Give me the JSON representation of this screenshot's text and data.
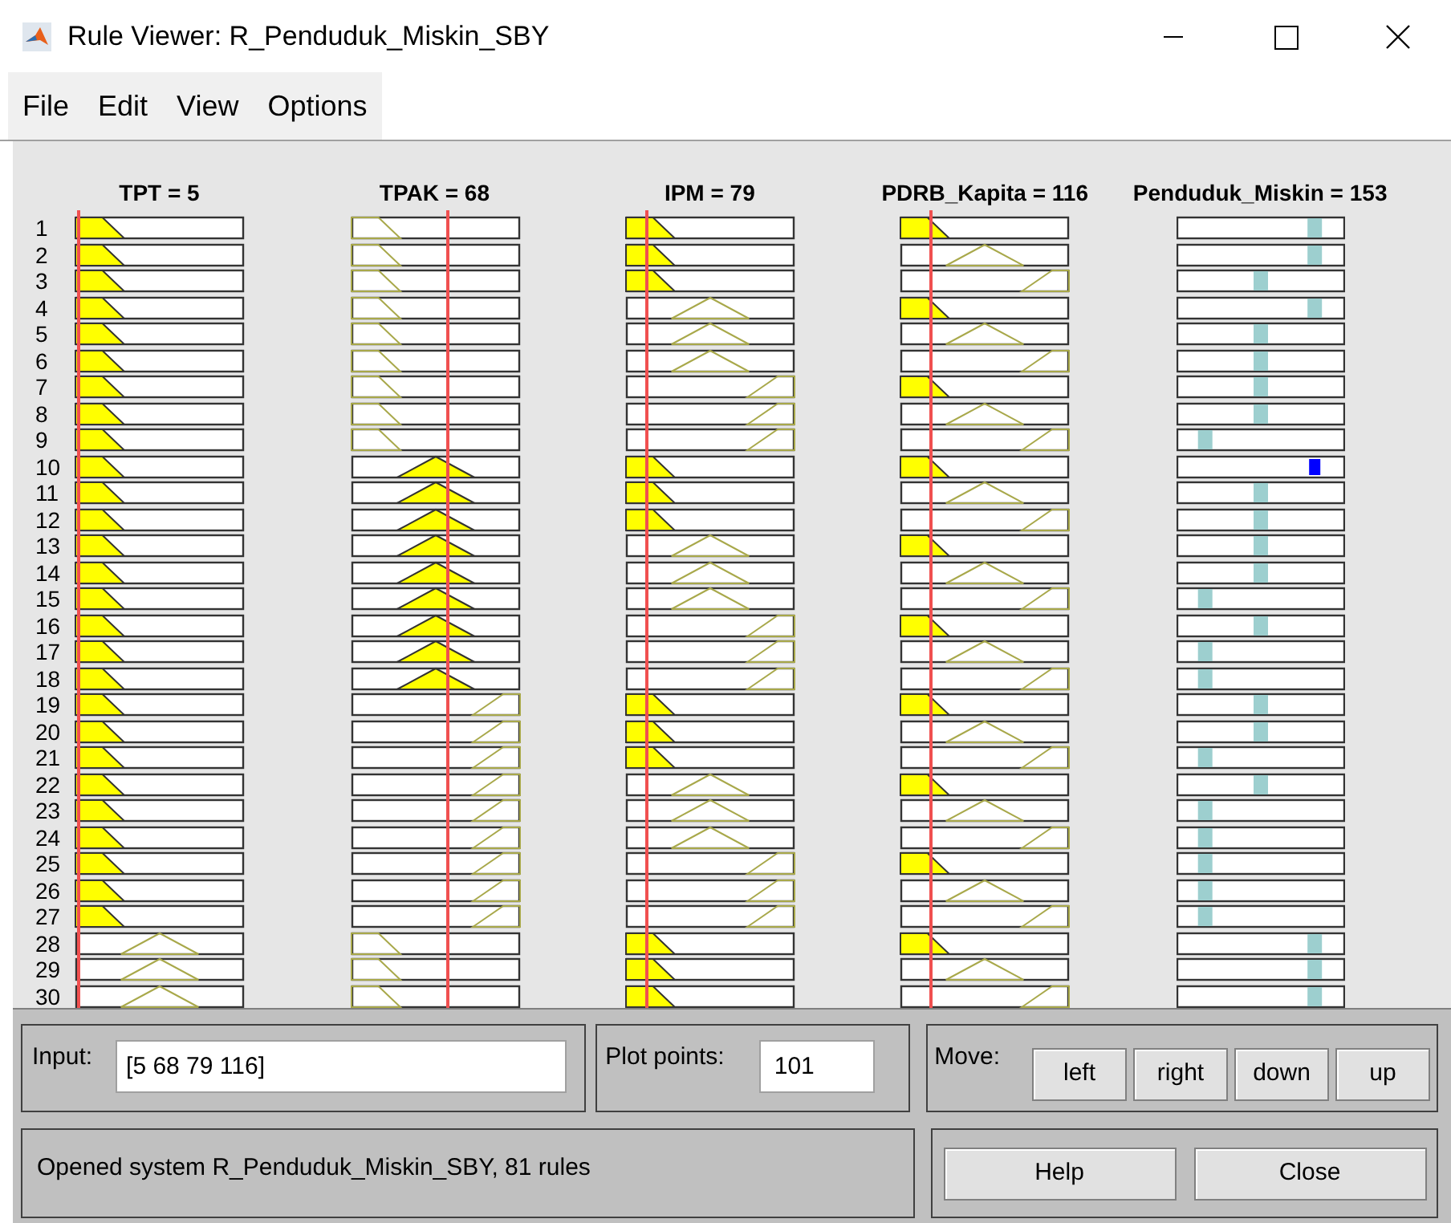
{
  "window": {
    "title": "Rule Viewer: R_Penduduk_Miskin_SBY"
  },
  "menu": [
    "File",
    "Edit",
    "View",
    "Options"
  ],
  "columns": [
    {
      "label": "TPT = 5",
      "kind": "input"
    },
    {
      "label": "TPAK = 68",
      "kind": "input"
    },
    {
      "label": "IPM = 79",
      "kind": "input"
    },
    {
      "label": "PDRB_Kapita = 116",
      "kind": "input"
    },
    {
      "label": "Penduduk_Miskin = 153",
      "kind": "output"
    }
  ],
  "rules": [
    {
      "number": "1",
      "cells": [
        {
          "kind": "low",
          "filled": true
        },
        {
          "kind": "low",
          "filled": false
        },
        {
          "kind": "low",
          "filled": true
        },
        {
          "kind": "low",
          "filled": true
        },
        {
          "kind": "high",
          "filled": false
        }
      ]
    },
    {
      "number": "2",
      "cells": [
        {
          "kind": "low",
          "filled": true
        },
        {
          "kind": "low",
          "filled": false
        },
        {
          "kind": "low",
          "filled": true
        },
        {
          "kind": "mid",
          "filled": false
        },
        {
          "kind": "high",
          "filled": false
        }
      ]
    },
    {
      "number": "3",
      "cells": [
        {
          "kind": "low",
          "filled": true
        },
        {
          "kind": "low",
          "filled": false
        },
        {
          "kind": "low",
          "filled": true
        },
        {
          "kind": "high",
          "filled": false
        },
        {
          "kind": "mid",
          "filled": false
        }
      ]
    },
    {
      "number": "4",
      "cells": [
        {
          "kind": "low",
          "filled": true
        },
        {
          "kind": "low",
          "filled": false
        },
        {
          "kind": "mid",
          "filled": false
        },
        {
          "kind": "low",
          "filled": true
        },
        {
          "kind": "high",
          "filled": false
        }
      ]
    },
    {
      "number": "5",
      "cells": [
        {
          "kind": "low",
          "filled": true
        },
        {
          "kind": "low",
          "filled": false
        },
        {
          "kind": "mid",
          "filled": false
        },
        {
          "kind": "mid",
          "filled": false
        },
        {
          "kind": "mid",
          "filled": false
        }
      ]
    },
    {
      "number": "6",
      "cells": [
        {
          "kind": "low",
          "filled": true
        },
        {
          "kind": "low",
          "filled": false
        },
        {
          "kind": "mid",
          "filled": false
        },
        {
          "kind": "high",
          "filled": false
        },
        {
          "kind": "mid",
          "filled": false
        }
      ]
    },
    {
      "number": "7",
      "cells": [
        {
          "kind": "low",
          "filled": true
        },
        {
          "kind": "low",
          "filled": false
        },
        {
          "kind": "high",
          "filled": false
        },
        {
          "kind": "low",
          "filled": true
        },
        {
          "kind": "mid",
          "filled": false
        }
      ]
    },
    {
      "number": "8",
      "cells": [
        {
          "kind": "low",
          "filled": true
        },
        {
          "kind": "low",
          "filled": false
        },
        {
          "kind": "high",
          "filled": false
        },
        {
          "kind": "mid",
          "filled": false
        },
        {
          "kind": "mid",
          "filled": false
        }
      ]
    },
    {
      "number": "9",
      "cells": [
        {
          "kind": "low",
          "filled": true
        },
        {
          "kind": "low",
          "filled": false
        },
        {
          "kind": "high",
          "filled": false
        },
        {
          "kind": "high",
          "filled": false
        },
        {
          "kind": "low",
          "filled": false
        }
      ]
    },
    {
      "number": "10",
      "cells": [
        {
          "kind": "low",
          "filled": true
        },
        {
          "kind": "mid",
          "filled": true
        },
        {
          "kind": "low",
          "filled": true
        },
        {
          "kind": "low",
          "filled": true
        },
        {
          "kind": "high",
          "filled": true
        }
      ]
    },
    {
      "number": "11",
      "cells": [
        {
          "kind": "low",
          "filled": true
        },
        {
          "kind": "mid",
          "filled": true
        },
        {
          "kind": "low",
          "filled": true
        },
        {
          "kind": "mid",
          "filled": false
        },
        {
          "kind": "mid",
          "filled": false
        }
      ]
    },
    {
      "number": "12",
      "cells": [
        {
          "kind": "low",
          "filled": true
        },
        {
          "kind": "mid",
          "filled": true
        },
        {
          "kind": "low",
          "filled": true
        },
        {
          "kind": "high",
          "filled": false
        },
        {
          "kind": "mid",
          "filled": false
        }
      ]
    },
    {
      "number": "13",
      "cells": [
        {
          "kind": "low",
          "filled": true
        },
        {
          "kind": "mid",
          "filled": true
        },
        {
          "kind": "mid",
          "filled": false
        },
        {
          "kind": "low",
          "filled": true
        },
        {
          "kind": "mid",
          "filled": false
        }
      ]
    },
    {
      "number": "14",
      "cells": [
        {
          "kind": "low",
          "filled": true
        },
        {
          "kind": "mid",
          "filled": true
        },
        {
          "kind": "mid",
          "filled": false
        },
        {
          "kind": "mid",
          "filled": false
        },
        {
          "kind": "mid",
          "filled": false
        }
      ]
    },
    {
      "number": "15",
      "cells": [
        {
          "kind": "low",
          "filled": true
        },
        {
          "kind": "mid",
          "filled": true
        },
        {
          "kind": "mid",
          "filled": false
        },
        {
          "kind": "high",
          "filled": false
        },
        {
          "kind": "low",
          "filled": false
        }
      ]
    },
    {
      "number": "16",
      "cells": [
        {
          "kind": "low",
          "filled": true
        },
        {
          "kind": "mid",
          "filled": true
        },
        {
          "kind": "high",
          "filled": false
        },
        {
          "kind": "low",
          "filled": true
        },
        {
          "kind": "mid",
          "filled": false
        }
      ]
    },
    {
      "number": "17",
      "cells": [
        {
          "kind": "low",
          "filled": true
        },
        {
          "kind": "mid",
          "filled": true
        },
        {
          "kind": "high",
          "filled": false
        },
        {
          "kind": "mid",
          "filled": false
        },
        {
          "kind": "low",
          "filled": false
        }
      ]
    },
    {
      "number": "18",
      "cells": [
        {
          "kind": "low",
          "filled": true
        },
        {
          "kind": "mid",
          "filled": true
        },
        {
          "kind": "high",
          "filled": false
        },
        {
          "kind": "high",
          "filled": false
        },
        {
          "kind": "low",
          "filled": false
        }
      ]
    },
    {
      "number": "19",
      "cells": [
        {
          "kind": "low",
          "filled": true
        },
        {
          "kind": "high",
          "filled": false
        },
        {
          "kind": "low",
          "filled": true
        },
        {
          "kind": "low",
          "filled": true
        },
        {
          "kind": "mid",
          "filled": false
        }
      ]
    },
    {
      "number": "20",
      "cells": [
        {
          "kind": "low",
          "filled": true
        },
        {
          "kind": "high",
          "filled": false
        },
        {
          "kind": "low",
          "filled": true
        },
        {
          "kind": "mid",
          "filled": false
        },
        {
          "kind": "mid",
          "filled": false
        }
      ]
    },
    {
      "number": "21",
      "cells": [
        {
          "kind": "low",
          "filled": true
        },
        {
          "kind": "high",
          "filled": false
        },
        {
          "kind": "low",
          "filled": true
        },
        {
          "kind": "high",
          "filled": false
        },
        {
          "kind": "low",
          "filled": false
        }
      ]
    },
    {
      "number": "22",
      "cells": [
        {
          "kind": "low",
          "filled": true
        },
        {
          "kind": "high",
          "filled": false
        },
        {
          "kind": "mid",
          "filled": false
        },
        {
          "kind": "low",
          "filled": true
        },
        {
          "kind": "mid",
          "filled": false
        }
      ]
    },
    {
      "number": "23",
      "cells": [
        {
          "kind": "low",
          "filled": true
        },
        {
          "kind": "high",
          "filled": false
        },
        {
          "kind": "mid",
          "filled": false
        },
        {
          "kind": "mid",
          "filled": false
        },
        {
          "kind": "low",
          "filled": false
        }
      ]
    },
    {
      "number": "24",
      "cells": [
        {
          "kind": "low",
          "filled": true
        },
        {
          "kind": "high",
          "filled": false
        },
        {
          "kind": "mid",
          "filled": false
        },
        {
          "kind": "high",
          "filled": false
        },
        {
          "kind": "low",
          "filled": false
        }
      ]
    },
    {
      "number": "25",
      "cells": [
        {
          "kind": "low",
          "filled": true
        },
        {
          "kind": "high",
          "filled": false
        },
        {
          "kind": "high",
          "filled": false
        },
        {
          "kind": "low",
          "filled": true
        },
        {
          "kind": "low",
          "filled": false
        }
      ]
    },
    {
      "number": "26",
      "cells": [
        {
          "kind": "low",
          "filled": true
        },
        {
          "kind": "high",
          "filled": false
        },
        {
          "kind": "high",
          "filled": false
        },
        {
          "kind": "mid",
          "filled": false
        },
        {
          "kind": "low",
          "filled": false
        }
      ]
    },
    {
      "number": "27",
      "cells": [
        {
          "kind": "low",
          "filled": true
        },
        {
          "kind": "high",
          "filled": false
        },
        {
          "kind": "high",
          "filled": false
        },
        {
          "kind": "high",
          "filled": false
        },
        {
          "kind": "low",
          "filled": false
        }
      ]
    },
    {
      "number": "28",
      "cells": [
        {
          "kind": "mid",
          "filled": false
        },
        {
          "kind": "low",
          "filled": false
        },
        {
          "kind": "low",
          "filled": true
        },
        {
          "kind": "low",
          "filled": true
        },
        {
          "kind": "high",
          "filled": false
        }
      ]
    },
    {
      "number": "29",
      "cells": [
        {
          "kind": "mid",
          "filled": false
        },
        {
          "kind": "low",
          "filled": false
        },
        {
          "kind": "low",
          "filled": true
        },
        {
          "kind": "mid",
          "filled": false
        },
        {
          "kind": "high",
          "filled": false
        }
      ]
    },
    {
      "number": "30",
      "cells": [
        {
          "kind": "mid",
          "filled": false
        },
        {
          "kind": "low",
          "filled": false
        },
        {
          "kind": "low",
          "filled": true
        },
        {
          "kind": "high",
          "filled": false
        },
        {
          "kind": "high",
          "filled": false
        }
      ]
    }
  ],
  "input": {
    "label": "Input:",
    "value": "[5 68 79 116]"
  },
  "plot_points": {
    "label": "Plot points:",
    "value": "101"
  },
  "move": {
    "label": "Move:",
    "buttons": [
      "left",
      "right",
      "down",
      "up"
    ]
  },
  "status": "Opened system R_Penduduk_Miskin_SBY, 81 rules",
  "buttons": [
    "Help",
    "Close"
  ]
}
